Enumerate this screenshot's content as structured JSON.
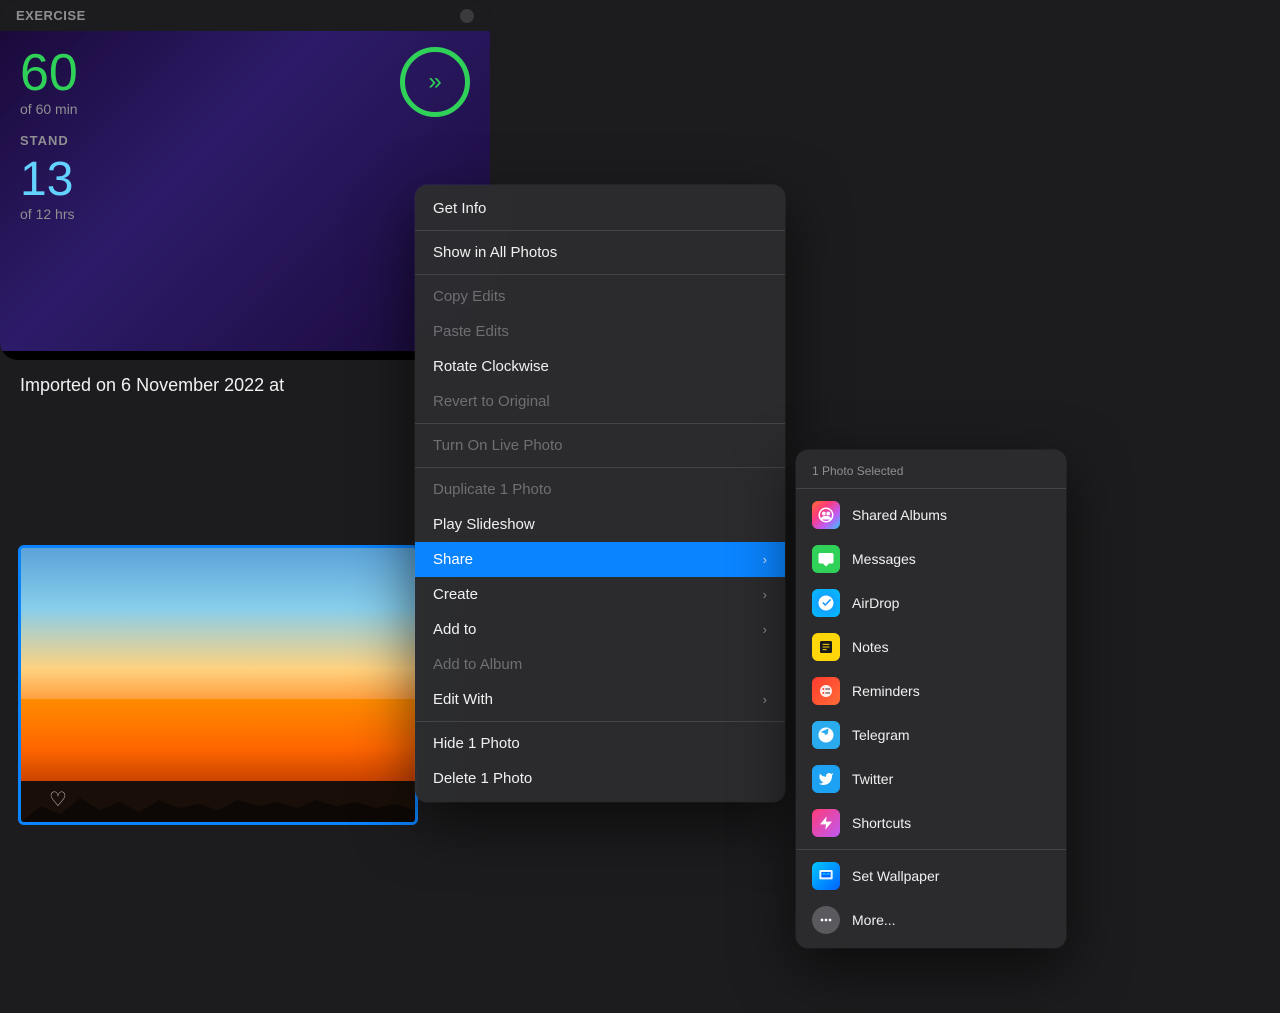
{
  "widget": {
    "title": "EXERCISE",
    "exercise_number": "60",
    "exercise_sub": "of 60 min",
    "stand_label": "STAND",
    "stand_number": "13",
    "stand_sub": "of 12 hrs"
  },
  "imported_label": "Imported on 6 November 2022 at",
  "context_menu": {
    "items": [
      {
        "id": "get-info",
        "label": "Get Info",
        "disabled": false,
        "has_submenu": false,
        "divider_after": true
      },
      {
        "id": "show-in-all-photos",
        "label": "Show in All Photos",
        "disabled": false,
        "has_submenu": false,
        "divider_after": true
      },
      {
        "id": "copy-edits",
        "label": "Copy Edits",
        "disabled": true,
        "has_submenu": false,
        "divider_after": false
      },
      {
        "id": "paste-edits",
        "label": "Paste Edits",
        "disabled": true,
        "has_submenu": false,
        "divider_after": false
      },
      {
        "id": "rotate-clockwise",
        "label": "Rotate Clockwise",
        "disabled": false,
        "has_submenu": false,
        "divider_after": false
      },
      {
        "id": "revert-to-original",
        "label": "Revert to Original",
        "disabled": true,
        "has_submenu": false,
        "divider_after": true
      },
      {
        "id": "turn-on-live-photo",
        "label": "Turn On Live Photo",
        "disabled": true,
        "has_submenu": false,
        "divider_after": true
      },
      {
        "id": "duplicate-1-photo",
        "label": "Duplicate 1 Photo",
        "disabled": true,
        "has_submenu": false,
        "divider_after": false
      },
      {
        "id": "play-slideshow",
        "label": "Play Slideshow",
        "disabled": false,
        "has_submenu": false,
        "divider_after": false
      },
      {
        "id": "share",
        "label": "Share",
        "disabled": false,
        "has_submenu": true,
        "highlighted": true,
        "divider_after": false
      },
      {
        "id": "create",
        "label": "Create",
        "disabled": false,
        "has_submenu": true,
        "divider_after": false
      },
      {
        "id": "add-to",
        "label": "Add to",
        "disabled": false,
        "has_submenu": true,
        "divider_after": false
      },
      {
        "id": "add-to-album",
        "label": "Add to Album",
        "disabled": true,
        "has_submenu": false,
        "divider_after": false
      },
      {
        "id": "edit-with",
        "label": "Edit With",
        "disabled": false,
        "has_submenu": true,
        "divider_after": true
      },
      {
        "id": "hide-1-photo",
        "label": "Hide 1 Photo",
        "disabled": false,
        "has_submenu": false,
        "divider_after": false
      },
      {
        "id": "delete-1-photo",
        "label": "Delete 1 Photo",
        "disabled": false,
        "has_submenu": false,
        "divider_after": false
      }
    ]
  },
  "share_submenu": {
    "header": "1 Photo Selected",
    "items": [
      {
        "id": "shared-albums",
        "label": "Shared Albums",
        "icon_class": "icon-shared-albums",
        "icon_char": "📸"
      },
      {
        "id": "messages",
        "label": "Messages",
        "icon_class": "icon-messages",
        "icon_char": "💬"
      },
      {
        "id": "airdrop",
        "label": "AirDrop",
        "icon_class": "icon-airdrop",
        "icon_char": "📡"
      },
      {
        "id": "notes",
        "label": "Notes",
        "icon_class": "icon-notes",
        "icon_char": "📝"
      },
      {
        "id": "reminders",
        "label": "Reminders",
        "icon_class": "icon-reminders",
        "icon_char": "🔴"
      },
      {
        "id": "telegram",
        "label": "Telegram",
        "icon_class": "icon-telegram",
        "icon_char": "✈"
      },
      {
        "id": "twitter",
        "label": "Twitter",
        "icon_class": "icon-twitter",
        "icon_char": "🐦"
      },
      {
        "id": "shortcuts",
        "label": "Shortcuts",
        "icon_class": "icon-shortcuts",
        "icon_char": "⚡"
      },
      {
        "id": "set-wallpaper",
        "label": "Set Wallpaper",
        "icon_class": "icon-wallpaper",
        "icon_char": "🖼"
      },
      {
        "id": "more",
        "label": "More...",
        "icon_class": "icon-more",
        "icon_char": "···"
      }
    ]
  }
}
